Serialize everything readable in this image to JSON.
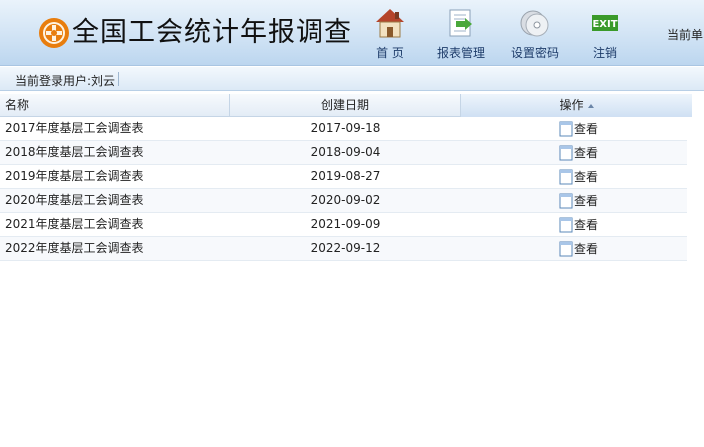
{
  "header": {
    "title": "全国工会统计年报调查",
    "nav": [
      {
        "id": "home",
        "label": "首 页",
        "icon": "house-icon"
      },
      {
        "id": "report",
        "label": "报表管理",
        "icon": "report-arrow-icon"
      },
      {
        "id": "password",
        "label": "设置密码",
        "icon": "disc-icon"
      },
      {
        "id": "logout",
        "label": "注销",
        "icon": "exit-icon"
      }
    ],
    "current_unit_label": "当前单"
  },
  "login_bar": {
    "text": "当前登录用户:刘云"
  },
  "grid": {
    "columns": [
      {
        "label": "名称"
      },
      {
        "label": "创建日期"
      },
      {
        "label": "操作",
        "sort": "ascending"
      }
    ],
    "rows": [
      {
        "name": "2017年度基层工会调查表",
        "date": "2017-09-18",
        "action": "查看"
      },
      {
        "name": "2018年度基层工会调查表",
        "date": "2018-09-04",
        "action": "查看"
      },
      {
        "name": "2019年度基层工会调查表",
        "date": "2019-08-27",
        "action": "查看"
      },
      {
        "name": "2020年度基层工会调查表",
        "date": "2020-09-02",
        "action": "查看"
      },
      {
        "name": "2021年度基层工会调查表",
        "date": "2021-09-09",
        "action": "查看"
      },
      {
        "name": "2022年度基层工会调查表",
        "date": "2022-09-12",
        "action": "查看"
      }
    ]
  },
  "colors": {
    "logo_orange": "#e87d0d",
    "header_bg": "#cfe2f4",
    "exit_green": "#3a9a2a"
  }
}
